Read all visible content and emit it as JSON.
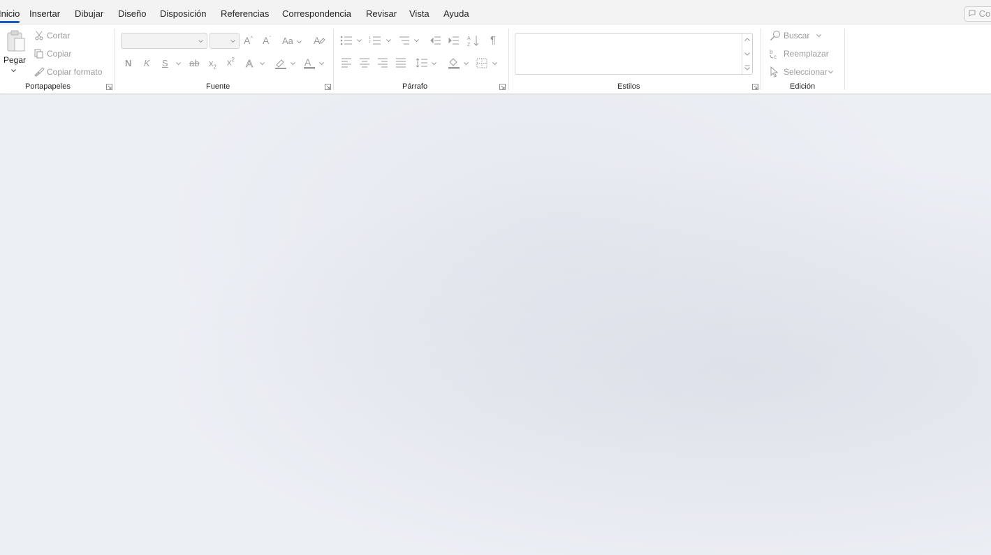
{
  "menubar": {
    "tabs": [
      {
        "label": "Inicio"
      },
      {
        "label": "Insertar"
      },
      {
        "label": "Dibujar"
      },
      {
        "label": "Diseño"
      },
      {
        "label": "Disposición"
      },
      {
        "label": "Referencias"
      },
      {
        "label": "Correspondencia"
      },
      {
        "label": "Revisar"
      },
      {
        "label": "Vista"
      },
      {
        "label": "Ayuda"
      }
    ],
    "share_label": "Co"
  },
  "clipboard": {
    "paste_label": "Pegar",
    "cut_label": "Cortar",
    "copy_label": "Copiar",
    "format_painter_label": "Copiar formato",
    "group_label": "Portapapeles"
  },
  "font": {
    "bold_label": "N",
    "italic_label": "K",
    "underline_label": "S",
    "strike_label": "ab",
    "change_case_label": "Aa",
    "group_label": "Fuente"
  },
  "paragraph": {
    "group_label": "Párrafo"
  },
  "styles": {
    "group_label": "Estilos"
  },
  "editing": {
    "find_label": "Buscar",
    "replace_label": "Reemplazar",
    "select_label": "Seleccionar",
    "group_label": "Edición"
  },
  "colors": {
    "accent": "#185abd",
    "ribbon_bg": "#ffffff",
    "menubar_bg": "#f3f3f3",
    "canvas_bg": "#eceff4",
    "disabled_text": "#9a9a9a"
  }
}
